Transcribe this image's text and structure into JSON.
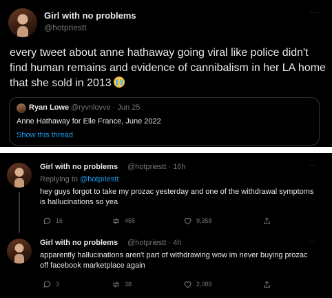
{
  "top_tweet": {
    "author_name": "Girl with no problems",
    "author_handle": "@hotpriestt",
    "more_label": "···",
    "text": "every tweet about anne hathaway going viral like police didn't find human remains and evidence of cannibalism in her LA home that she sold in 2013",
    "emoji_icon": "crying-face-icon",
    "quote": {
      "author_name": "Ryan Lowe",
      "meta": "@ryvnlovve · Jun 25",
      "text": "Anne Hathaway for Elle France, June 2022",
      "show_thread": "Show this thread"
    }
  },
  "replies": [
    {
      "author_name": "Girl with no problems",
      "meta": "@hotpriestt · 16h",
      "replying_prefix": "Replying to",
      "replying_handle": "@hotpriestt",
      "text": "hey guys forgot to take my prozac yesterday and one of the withdrawal symptoms is hallucinations so yea",
      "more_label": "···",
      "replies": "16",
      "retweets": "455",
      "likes": "9,358"
    },
    {
      "author_name": "Girl with no problems",
      "meta": "@hotpriestt · 4h",
      "text": "apparently hallucinations aren't part of withdrawing wow im never buying prozac off facebook marketplace again",
      "more_label": "···",
      "replies": "3",
      "retweets": "38",
      "likes": "2,089"
    }
  ],
  "colors": {
    "background": "#000000",
    "text": "#e7e9ea",
    "muted": "#71767b",
    "link": "#1d9bf0",
    "divider": "#ffffff"
  }
}
